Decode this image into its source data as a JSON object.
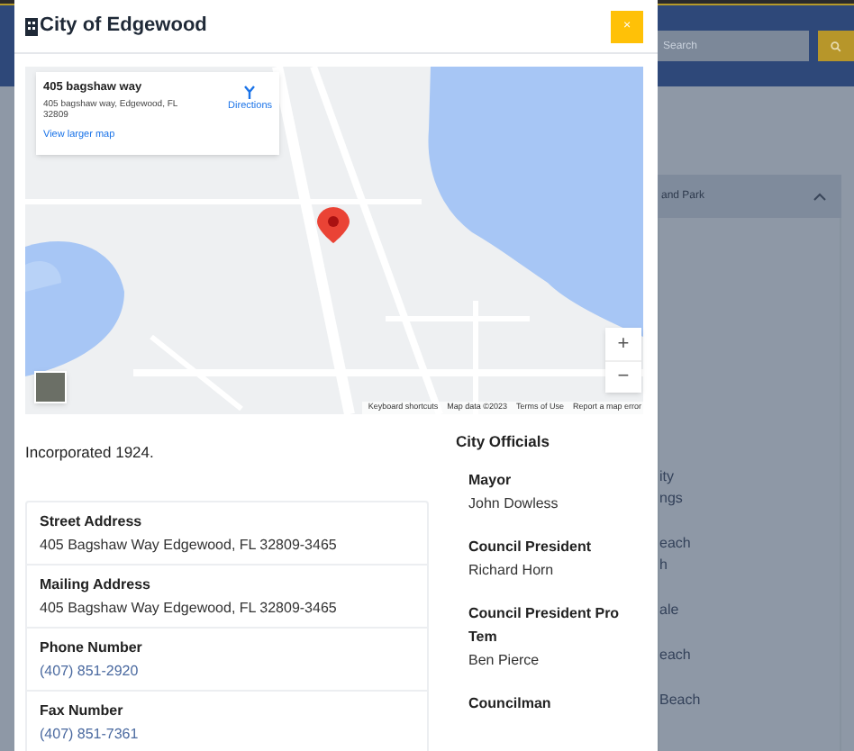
{
  "background_page": {
    "search": {
      "placeholder": "Search"
    },
    "accordion": {
      "title": "and Park",
      "expanded": true
    },
    "fragments": [
      {
        "lines": [
          "ity",
          "ngs"
        ]
      },
      {
        "lines": [
          "each",
          "h"
        ]
      },
      {
        "lines": [
          "ale"
        ]
      },
      {
        "lines": [
          "each"
        ]
      },
      {
        "lines": [
          "Beach"
        ]
      }
    ]
  },
  "modal": {
    "title": "City of Edgewood",
    "close_label": "×",
    "map": {
      "info_card": {
        "title": "405 bagshaw way",
        "address": "405 bagshaw way, Edgewood, FL 32809",
        "directions": "Directions",
        "link": "View larger map"
      },
      "zoom_in": "+",
      "zoom_out": "−",
      "attribution": [
        "Keyboard shortcuts",
        "Map data ©2023",
        "Terms of Use",
        "Report a map error"
      ]
    },
    "intro": "Incorporated 1924.",
    "contact": [
      {
        "label": "Street Address",
        "value": "405 Bagshaw Way Edgewood, FL 32809-3465",
        "kind": "text"
      },
      {
        "label": "Mailing Address",
        "value": "405 Bagshaw Way Edgewood, FL 32809-3465",
        "kind": "text"
      },
      {
        "label": "Phone Number",
        "value": "(407) 851-2920",
        "kind": "link"
      },
      {
        "label": "Fax Number",
        "value": "(407) 851-7361",
        "kind": "link"
      }
    ],
    "officials_heading": "City Officials",
    "officials": [
      {
        "role": "Mayor",
        "name": "John Dowless"
      },
      {
        "role": "Council President",
        "name": "Richard Horn"
      },
      {
        "role": "Council President Pro Tem",
        "name": "Ben Pierce"
      },
      {
        "role": "Councilman"
      }
    ]
  }
}
